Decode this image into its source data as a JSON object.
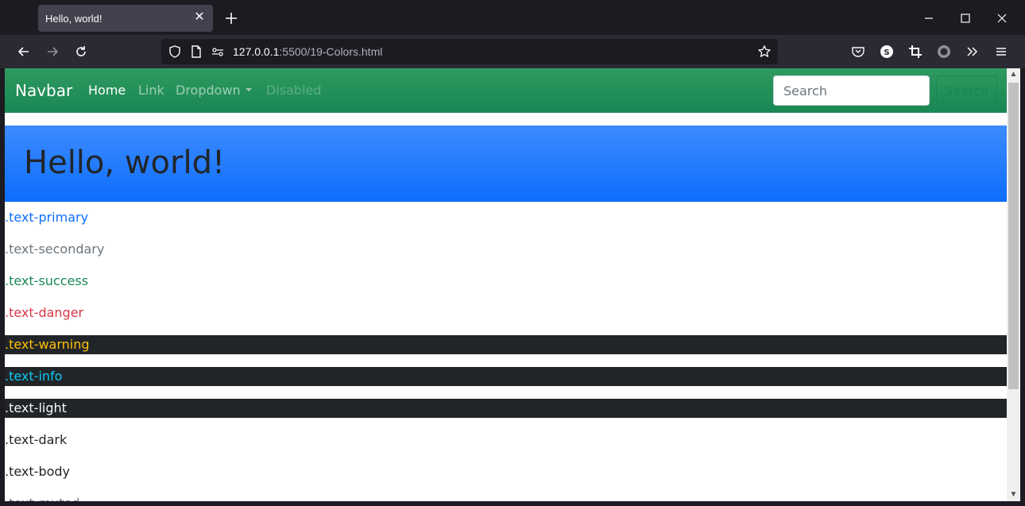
{
  "browser": {
    "tab_title": "Hello, world!",
    "tab_close": "✕",
    "new_tab": "+",
    "url_host": "127.0.0.1",
    "url_path": ":5500/19-Colors.html"
  },
  "navbar": {
    "brand": "Navbar",
    "links": [
      {
        "label": "Home",
        "state": "active"
      },
      {
        "label": "Link",
        "state": "normal"
      },
      {
        "label": "Dropdown",
        "state": "dropdown"
      },
      {
        "label": "Disabled",
        "state": "disabled"
      }
    ],
    "search_placeholder": "Search",
    "search_button": "Search",
    "color": "#198754"
  },
  "jumbotron": {
    "heading": "Hello, world!",
    "color": "#0d6efd"
  },
  "text_classes": [
    {
      "label": ".text-primary",
      "color": "#0d6efd",
      "dark_bg": false
    },
    {
      "label": ".text-secondary",
      "color": "#6c757d",
      "dark_bg": false
    },
    {
      "label": ".text-success",
      "color": "#198754",
      "dark_bg": false
    },
    {
      "label": ".text-danger",
      "color": "#dc3545",
      "dark_bg": false
    },
    {
      "label": ".text-warning",
      "color": "#ffc107",
      "dark_bg": true
    },
    {
      "label": ".text-info",
      "color": "#0dcaf0",
      "dark_bg": true
    },
    {
      "label": ".text-light",
      "color": "#f8f9fa",
      "dark_bg": true
    },
    {
      "label": ".text-dark",
      "color": "#212529",
      "dark_bg": false
    },
    {
      "label": ".text-body",
      "color": "#212529",
      "dark_bg": false
    },
    {
      "label": ".text-muted",
      "color": "#6c757d",
      "dark_bg": false
    }
  ],
  "icons": {
    "back": "back-arrow-icon",
    "forward": "forward-arrow-icon",
    "reload": "reload-icon",
    "shield": "shield-icon",
    "page": "page-icon",
    "permissions": "permissions-icon",
    "bookmark": "star-icon",
    "pocket": "pocket-icon",
    "extension_s": "s-extension-icon",
    "crop": "crop-icon",
    "circle": "record-icon",
    "overflow": "chevrons-right-icon",
    "menu": "hamburger-menu-icon"
  }
}
